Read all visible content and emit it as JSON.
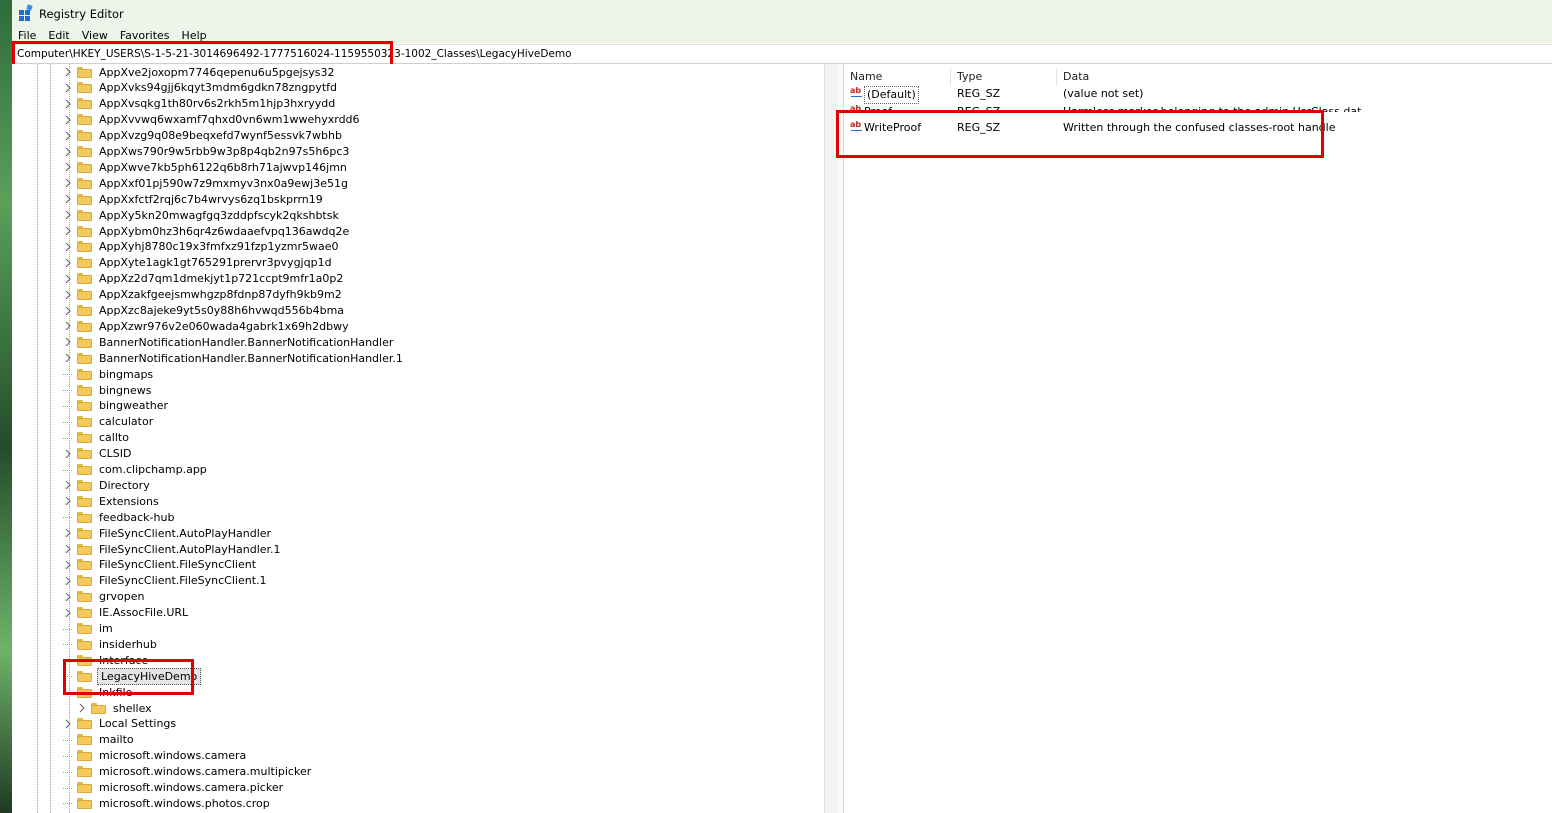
{
  "window": {
    "title": "Registry Editor"
  },
  "menu": [
    "File",
    "Edit",
    "View",
    "Favorites",
    "Help"
  ],
  "address": "Computer\\HKEY_USERS\\S-1-5-21-3014696492-1777516024-1159550323-1002_Classes\\LegacyHiveDemo",
  "tree": [
    {
      "label": "AppXve2joxopm7746qepenu6u5pgejsys32",
      "expandable": true,
      "level": 0
    },
    {
      "label": "AppXvks94gjj6kqyt3mdm6gdkn78zngpytfd",
      "expandable": true,
      "level": 0
    },
    {
      "label": "AppXvsqkg1th80rv6s2rkh5m1hjp3hxryydd",
      "expandable": true,
      "level": 0
    },
    {
      "label": "AppXvvwq6wxamf7qhxd0vn6wm1wwehyxrdd6",
      "expandable": true,
      "level": 0
    },
    {
      "label": "AppXvzg9q08e9beqxefd7wynf5essvk7wbhb",
      "expandable": true,
      "level": 0
    },
    {
      "label": "AppXws790r9w5rbb9w3p8p4qb2n97s5h6pc3",
      "expandable": true,
      "level": 0
    },
    {
      "label": "AppXwve7kb5ph6122q6b8rh71ajwvp146jmn",
      "expandable": true,
      "level": 0
    },
    {
      "label": "AppXxf01pj590w7z9mxmyv3nx0a9ewj3e51g",
      "expandable": true,
      "level": 0
    },
    {
      "label": "AppXxfctf2rqj6c7b4wrvys6zq1bskprrn19",
      "expandable": true,
      "level": 0
    },
    {
      "label": "AppXy5kn20mwagfgq3zddpfscyk2qkshbtsk",
      "expandable": true,
      "level": 0
    },
    {
      "label": "AppXybm0hz3h6qr4z6wdaaefvpq136awdq2e",
      "expandable": true,
      "level": 0
    },
    {
      "label": "AppXyhj8780c19x3fmfxz91fzp1yzmr5wae0",
      "expandable": true,
      "level": 0
    },
    {
      "label": "AppXyte1agk1gt765291prervr3pvygjqp1d",
      "expandable": true,
      "level": 0
    },
    {
      "label": "AppXz2d7qm1dmekjyt1p721ccpt9mfr1a0p2",
      "expandable": true,
      "level": 0
    },
    {
      "label": "AppXzakfgeejsmwhgzp8fdnp87dyfh9kb9m2",
      "expandable": true,
      "level": 0
    },
    {
      "label": "AppXzc8ajeke9yt5s0y88h6hvwqd556b4bma",
      "expandable": true,
      "level": 0
    },
    {
      "label": "AppXzwr976v2e060wada4gabrk1x69h2dbwy",
      "expandable": true,
      "level": 0
    },
    {
      "label": "BannerNotificationHandler.BannerNotificationHandler",
      "expandable": true,
      "level": 0
    },
    {
      "label": "BannerNotificationHandler.BannerNotificationHandler.1",
      "expandable": true,
      "level": 0
    },
    {
      "label": "bingmaps",
      "expandable": false,
      "level": 0
    },
    {
      "label": "bingnews",
      "expandable": false,
      "level": 0
    },
    {
      "label": "bingweather",
      "expandable": false,
      "level": 0
    },
    {
      "label": "calculator",
      "expandable": false,
      "level": 0
    },
    {
      "label": "callto",
      "expandable": false,
      "level": 0
    },
    {
      "label": "CLSID",
      "expandable": true,
      "level": 0
    },
    {
      "label": "com.clipchamp.app",
      "expandable": false,
      "level": 0
    },
    {
      "label": "Directory",
      "expandable": true,
      "level": 0
    },
    {
      "label": "Extensions",
      "expandable": true,
      "level": 0
    },
    {
      "label": "feedback-hub",
      "expandable": false,
      "level": 0
    },
    {
      "label": "FileSyncClient.AutoPlayHandler",
      "expandable": true,
      "level": 0
    },
    {
      "label": "FileSyncClient.AutoPlayHandler.1",
      "expandable": true,
      "level": 0
    },
    {
      "label": "FileSyncClient.FileSyncClient",
      "expandable": true,
      "level": 0
    },
    {
      "label": "FileSyncClient.FileSyncClient.1",
      "expandable": true,
      "level": 0
    },
    {
      "label": "grvopen",
      "expandable": true,
      "level": 0
    },
    {
      "label": "IE.AssocFile.URL",
      "expandable": true,
      "level": 0
    },
    {
      "label": "im",
      "expandable": false,
      "level": 0
    },
    {
      "label": "insiderhub",
      "expandable": false,
      "level": 0
    },
    {
      "label": "Interface",
      "expandable": false,
      "level": 0
    },
    {
      "label": "LegacyHiveDemo",
      "expandable": false,
      "level": 0,
      "selected": true
    },
    {
      "label": "Inkfile",
      "expandable": false,
      "level": 0
    },
    {
      "label": "shellex",
      "expandable": true,
      "level": 1
    },
    {
      "label": "Local Settings",
      "expandable": true,
      "level": 0
    },
    {
      "label": "mailto",
      "expandable": false,
      "level": 0
    },
    {
      "label": "microsoft.windows.camera",
      "expandable": false,
      "level": 0
    },
    {
      "label": "microsoft.windows.camera.multipicker",
      "expandable": false,
      "level": 0
    },
    {
      "label": "microsoft.windows.camera.picker",
      "expandable": false,
      "level": 0
    },
    {
      "label": "microsoft.windows.photos.crop",
      "expandable": false,
      "level": 0
    }
  ],
  "columns": {
    "name": "Name",
    "type": "Type",
    "data": "Data"
  },
  "values": [
    {
      "name": "(Default)",
      "type": "REG_SZ",
      "data": "(value not set)"
    },
    {
      "name": "Proof",
      "type": "REG_SZ",
      "data": "Harmless marker belonging to the admin UsrClass.dat"
    },
    {
      "name": "WriteProof",
      "type": "REG_SZ",
      "data": "Written through the confused classes-root handle"
    }
  ],
  "colors": {
    "highlight": "#e00000",
    "titlebar": "#eef4ea",
    "folder": "#f4c95b"
  }
}
